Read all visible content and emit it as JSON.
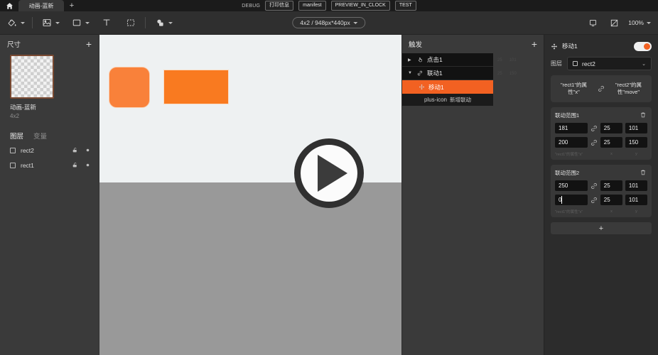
{
  "titlebar": {
    "home_icon": "home-icon",
    "tab_label": "动画-蓝新",
    "add_tab_label": "+",
    "dev": {
      "debug_label": "DEBUG",
      "print_label": "打印信息",
      "manifest_label": "manifest",
      "preview_label": "PREVIEW_IN_CLOCK",
      "test_label": "TEST"
    }
  },
  "toolbar": {
    "tools": [
      {
        "name": "fill-bucket-icon",
        "has_caret": true
      },
      {
        "name": "image-icon",
        "has_caret": true
      },
      {
        "name": "rectangle-icon",
        "has_caret": true
      },
      {
        "name": "text-icon",
        "has_caret": false
      },
      {
        "name": "marquee-select-icon",
        "has_caret": false
      },
      {
        "name": "shapes-icon",
        "has_caret": true
      }
    ],
    "canvas_size_label": "4x2 / 948px*440px",
    "device_icon": "device-preview-icon",
    "crop_icon": "crop-diagonal-icon",
    "zoom_label": "100%"
  },
  "left_panel": {
    "size_title": "尺寸",
    "add_label": "+",
    "thumb_title": "动画-蓝新",
    "thumb_sub": "4x2",
    "tabs": [
      {
        "label": "图层",
        "active": true
      },
      {
        "label": "变量",
        "active": false
      }
    ],
    "layers": [
      {
        "name": "rect2",
        "lock_icon": "unlock-icon",
        "eye_icon": "eye-icon"
      },
      {
        "name": "rect1",
        "lock_icon": "unlock-icon",
        "eye_icon": "eye-icon"
      }
    ]
  },
  "canvas": {
    "shape_a_color": "#f9813a",
    "shape_b_color": "#f97a20",
    "play_button_label": "play-button"
  },
  "trigger_panel": {
    "title": "触发",
    "add_label": "+",
    "items": [
      {
        "label": "点击1",
        "icon": "tap-hand-icon",
        "arrow": "▶",
        "selected": false
      },
      {
        "label": "联动1",
        "icon": "link-icon",
        "arrow": "▼",
        "selected": false
      },
      {
        "label": "移动1",
        "icon": "move-icon",
        "arrow": "",
        "selected": true
      }
    ],
    "add_link_label": "新增联动",
    "add_link_icon": "plus-icon"
  },
  "inspector": {
    "title": "移动1",
    "move_icon": "move-icon",
    "toggle_on": true,
    "accent_color": "#f26122",
    "layer_label": "图层",
    "layer_value": "rect2",
    "binding": {
      "left": "\"rect1\"的属性\"x\"",
      "link_icon": "link-icon",
      "right": "\"rect2\"的属性\"move\""
    },
    "ranges": [
      {
        "title": "联动范围1",
        "delete_icon": "trash-icon",
        "rows": [
          {
            "from": "181",
            "link_icon": "link-icon",
            "mid": "25",
            "end": "101"
          },
          {
            "from": "200",
            "link_icon": "link-icon",
            "mid": "25",
            "end": "150"
          }
        ],
        "foot": {
          "a": "\"rect1\"的属性\"x\"",
          "b": "x",
          "c": "y"
        }
      },
      {
        "title": "联动范围2",
        "delete_icon": "trash-icon",
        "rows": [
          {
            "from": "250",
            "link_icon": "link-icon",
            "mid": "25",
            "end": "101"
          },
          {
            "from": "0",
            "link_icon": "link-icon",
            "mid": "25",
            "end": "101",
            "editing": true
          }
        ],
        "foot": {
          "a": "\"rect1\"的属性\"x\"",
          "b": "x",
          "c": "y"
        }
      }
    ],
    "add_range_label": "+"
  },
  "ghost_rows": [
    {
      "a": "25",
      "b": "101"
    },
    {
      "a": "25",
      "b": "150"
    }
  ]
}
